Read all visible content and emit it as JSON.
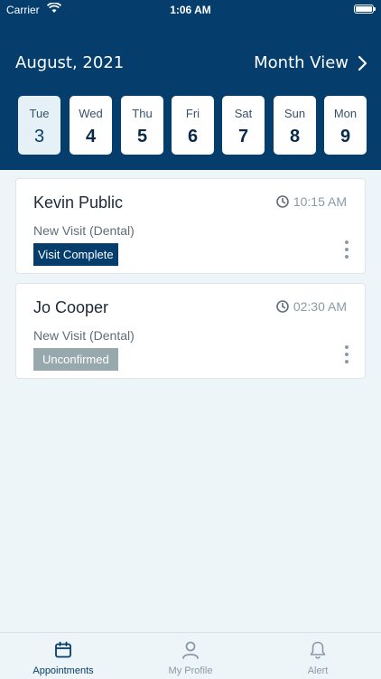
{
  "status_bar": {
    "carrier": "Carrier",
    "time": "1:06 AM"
  },
  "header": {
    "month_title": "August, 2021",
    "month_view_label": "Month View"
  },
  "days": [
    {
      "dow": "Tue",
      "num": "3",
      "selected": true
    },
    {
      "dow": "Wed",
      "num": "4",
      "selected": false
    },
    {
      "dow": "Thu",
      "num": "5",
      "selected": false
    },
    {
      "dow": "Fri",
      "num": "6",
      "selected": false
    },
    {
      "dow": "Sat",
      "num": "7",
      "selected": false
    },
    {
      "dow": "Sun",
      "num": "8",
      "selected": false
    },
    {
      "dow": "Mon",
      "num": "9",
      "selected": false
    }
  ],
  "appointments": [
    {
      "name": "Kevin  Public",
      "time": "10:15 AM",
      "visit_type": "New Visit (Dental)",
      "status": "Visit Complete",
      "status_color": "#053e6d"
    },
    {
      "name": "Jo  Cooper",
      "time": "02:30 AM",
      "visit_type": "New Visit (Dental)",
      "status": "Unconfirmed",
      "status_color": "#98a9ae"
    }
  ],
  "tabs": [
    {
      "label": "Appointments",
      "icon": "calendar-icon",
      "active": true
    },
    {
      "label": "My Profile",
      "icon": "person-icon",
      "active": false
    },
    {
      "label": "Alert",
      "icon": "bell-icon",
      "active": false
    }
  ],
  "colors": {
    "primary": "#053e6d",
    "background": "#eef5f8",
    "muted": "#8a9aa6"
  }
}
